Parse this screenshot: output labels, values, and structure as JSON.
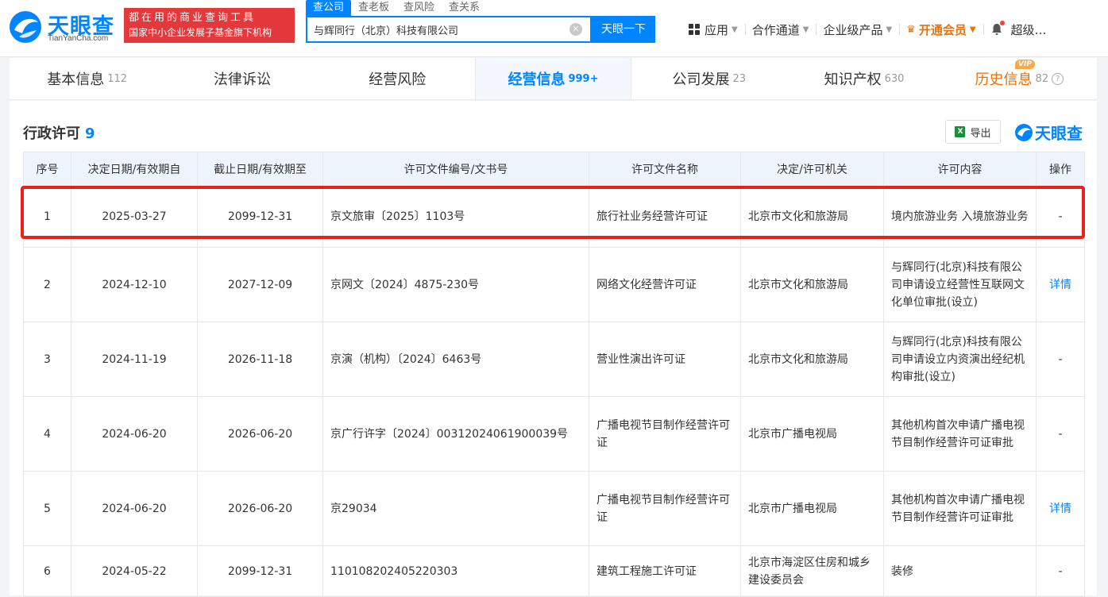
{
  "brand": {
    "logo_cn": "天眼查",
    "logo_en": "TianYanCha.com",
    "slogan_line1": "都在用的商业查询工具",
    "slogan_line2": "国家中小企业发展子基金旗下机构",
    "primary_color": "#0084ff",
    "accent_red": "#e4393c"
  },
  "search": {
    "tabs": [
      "查公司",
      "查老板",
      "查风险",
      "查关系"
    ],
    "value": "与辉同行（北京）科技有限公司",
    "button_label": "天眼一下"
  },
  "nav": {
    "apps": "应用",
    "channel": "合作通道",
    "enterprise": "企业级产品",
    "vip": "开通会员",
    "user": "超级…"
  },
  "main_tabs": [
    {
      "label": "基本信息",
      "count": "112"
    },
    {
      "label": "法律诉讼",
      "count": ""
    },
    {
      "label": "经营风险",
      "count": ""
    },
    {
      "label": "经营信息",
      "count": "999+"
    },
    {
      "label": "公司发展",
      "count": "23"
    },
    {
      "label": "知识产权",
      "count": "630"
    },
    {
      "label": "历史信息",
      "count": "82",
      "badge": "VIP"
    }
  ],
  "section": {
    "title": "行政许可",
    "count": "9",
    "export_label": "导出",
    "watermark": "天眼查"
  },
  "table": {
    "headers": [
      "序号",
      "决定日期/有效期自",
      "截止日期/有效期至",
      "许可文件编号/文书号",
      "许可文件名称",
      "决定/许可机关",
      "许可内容",
      "操作"
    ],
    "rows": [
      {
        "no": "1",
        "start": "2025-03-27",
        "end": "2099-12-31",
        "doc_no": "京文旅审〔2025〕1103号",
        "name": "旅行社业务经营许可证",
        "authority": "北京市文化和旅游局",
        "content": "境内旅游业务 入境旅游业务",
        "action": "-"
      },
      {
        "no": "2",
        "start": "2024-12-10",
        "end": "2027-12-09",
        "doc_no": "京网文〔2024〕4875-230号",
        "name": "网络文化经营许可证",
        "authority": "北京市文化和旅游局",
        "content": "与辉同行(北京)科技有限公司申请设立经营性互联网文化单位审批(设立)",
        "action": "详情"
      },
      {
        "no": "3",
        "start": "2024-11-19",
        "end": "2026-11-18",
        "doc_no": "京演（机构）〔2024〕6463号",
        "name": "营业性演出许可证",
        "authority": "北京市文化和旅游局",
        "content": "与辉同行(北京)科技有限公司申请设立内资演出经纪机构审批(设立)",
        "action": "-"
      },
      {
        "no": "4",
        "start": "2024-06-20",
        "end": "2026-06-20",
        "doc_no": "京广行许字〔2024〕00312024061900039号",
        "name": "广播电视节目制作经营许可证",
        "authority": "北京市广播电视局",
        "content": "其他机构首次申请广播电视节目制作经营许可证审批",
        "action": "-"
      },
      {
        "no": "5",
        "start": "2024-06-20",
        "end": "2026-06-20",
        "doc_no": "京29034",
        "name": "广播电视节目制作经营许可证",
        "authority": "北京市广播电视局",
        "content": "其他机构首次申请广播电视节目制作经营许可证审批",
        "action": "详情"
      },
      {
        "no": "6",
        "start": "2024-05-22",
        "end": "2099-12-31",
        "doc_no": "110108202405220303",
        "name": "建筑工程施工许可证",
        "authority": "北京市海淀区住房和城乡建设委员会",
        "content": "装修",
        "action": "-"
      }
    ]
  }
}
